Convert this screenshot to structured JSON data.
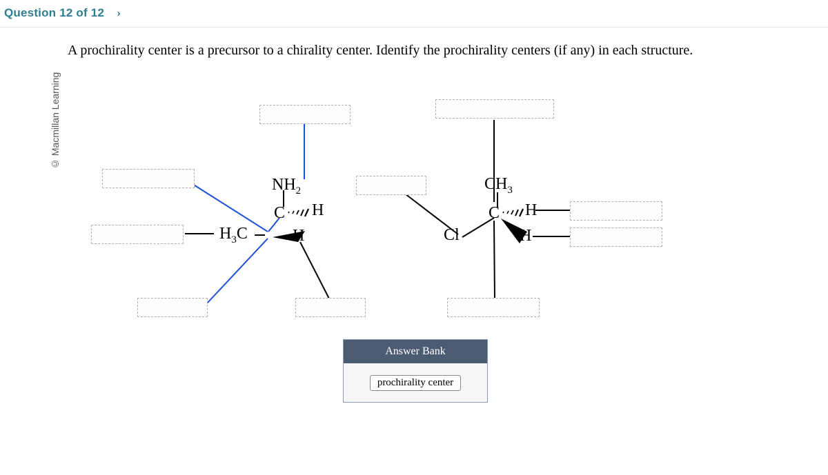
{
  "header": {
    "question_label": "Question 12 of 12",
    "next_glyph": "›"
  },
  "sidebar": {
    "copyright": "© Macmillan Learning"
  },
  "prompt": {
    "text": "A prochirality center is a precursor to a chirality center. Identify the prochirality centers (if any) in each structure."
  },
  "labels": {
    "nh2": "NH",
    "nh2_sub": "2",
    "h3c": "H",
    "h3c_sub": "3",
    "h3c_tail": "C",
    "c_top_h": "C",
    "c_top_hash": "H",
    "h_wedge_1": "H",
    "ch3": "CH",
    "ch3_sub": "3",
    "c2_h": "C",
    "c2_hash": "H",
    "cl": "Cl",
    "h_wedge_2": "H"
  },
  "answer_bank": {
    "title": "Answer Bank",
    "items": [
      "prochirality center"
    ]
  }
}
